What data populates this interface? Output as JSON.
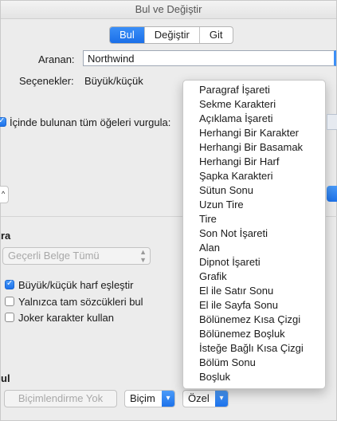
{
  "window": {
    "title": "Bul ve Değiştir"
  },
  "tabs": [
    {
      "label": "Bul",
      "active": true
    },
    {
      "label": "Değiştir",
      "active": false
    },
    {
      "label": "Git",
      "active": false
    }
  ],
  "search": {
    "label": "Aranan:",
    "value": "Northwind"
  },
  "options": {
    "label": "Seçenekler:",
    "value": "Büyük/küçük"
  },
  "highlight": {
    "label": "İçinde bulunan tüm öğeleri vurgula:",
    "checked": true
  },
  "search_section": {
    "label": "ra"
  },
  "scope_popup": {
    "value": "Geçerli Belge Tümü"
  },
  "checkboxes": [
    {
      "label": "Büyük/küçük harf eşleştir",
      "checked": true
    },
    {
      "label": "Yalnızca tam sözcükleri bul",
      "checked": false
    },
    {
      "label": "Joker karakter kullan",
      "checked": false
    }
  ],
  "find_section": {
    "label": "ul"
  },
  "bottom": {
    "no_format_label": "Biçimlendirme Yok",
    "format_label": "Biçim",
    "special_label": "Özel"
  },
  "special_menu": [
    "Paragraf İşareti",
    "Sekme Karakteri",
    "Açıklama İşareti",
    "Herhangi Bir Karakter",
    "Herhangi Bir Basamak",
    "Herhangi Bir Harf",
    "Şapka Karakteri",
    "Sütun Sonu",
    "Uzun Tire",
    "Tire",
    "Son Not İşareti",
    "Alan",
    "Dipnot İşareti",
    "Grafik",
    "El ile Satır Sonu",
    "El ile Sayfa Sonu",
    "Bölünemez Kısa Çizgi",
    "Bölünemez Boşluk",
    "İsteğe Bağlı Kısa Çizgi",
    "Bölüm Sonu",
    "Boşluk"
  ],
  "colors": {
    "accent": "#1d72ea",
    "accent_light": "#4a9bf9"
  }
}
